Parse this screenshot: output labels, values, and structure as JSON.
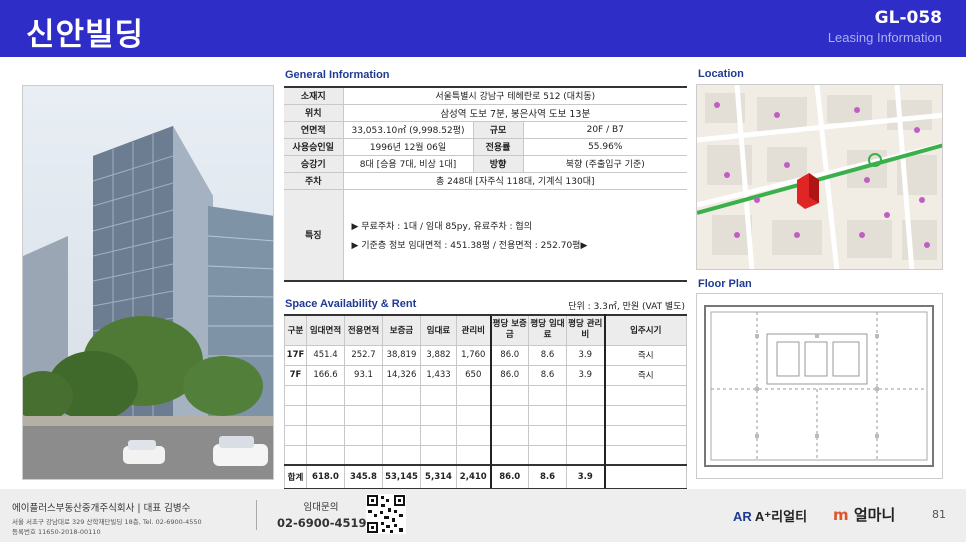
{
  "header": {
    "title": "신안빌딩",
    "code": "GL-058",
    "subtitle": "Leasing Information"
  },
  "general": {
    "section_title": "General Information",
    "address_label": "소재지",
    "address": "서울특별시 강남구 테헤란로 512 (대치동)",
    "location_label": "위치",
    "location": "삼성역 도보 7분, 봉은사역 도보 13분",
    "gfa_label": "연면적",
    "gfa": "33,053.10㎡ (9,998.52평)",
    "scale_label": "규모",
    "scale": "20F / B7",
    "approval_label": "사용승인일",
    "approval": "1996년 12월 06일",
    "efficiency_label": "전용률",
    "efficiency": "55.96%",
    "elevator_label": "승강기",
    "elevator": "8대 [승용 7대, 비상 1대]",
    "direction_label": "방향",
    "direction": "북향 (주출입구 기준)",
    "parking_label": "주차",
    "parking": "총 248대 [자주식 118대, 기계식 130대]",
    "features_label": "특징",
    "features": [
      "▶ 무료주차 : 1대 / 임대 85py, 유료주차 : 협의",
      "▶ 기준층 정보  임대면적 : 451.38평 / 전용면적 : 252.70평▶"
    ]
  },
  "availability": {
    "section_title": "Space Availability & Rent",
    "unit_note": "단위 : 3.3㎡, 만원 (VAT 별도)",
    "headers": [
      "구분",
      "임대면적",
      "전용면적",
      "보증금",
      "임대료",
      "관리비",
      "평당 보증금",
      "평당 임대료",
      "평당 관리비",
      "입주시기"
    ],
    "rows": [
      [
        "17F",
        "451.4",
        "252.7",
        "38,819",
        "3,882",
        "1,760",
        "86.0",
        "8.6",
        "3.9",
        "즉시"
      ],
      [
        "7F",
        "166.6",
        "93.1",
        "14,326",
        "1,433",
        "650",
        "86.0",
        "8.6",
        "3.9",
        "즉시"
      ],
      [
        "",
        "",
        "",
        "",
        "",
        "",
        "",
        "",
        "",
        ""
      ],
      [
        "",
        "",
        "",
        "",
        "",
        "",
        "",
        "",
        "",
        ""
      ],
      [
        "",
        "",
        "",
        "",
        "",
        "",
        "",
        "",
        "",
        ""
      ],
      [
        "",
        "",
        "",
        "",
        "",
        "",
        "",
        "",
        "",
        ""
      ]
    ],
    "total": [
      "합계",
      "618.0",
      "345.8",
      "53,145",
      "5,314",
      "2,410",
      "86.0",
      "8.6",
      "3.9",
      ""
    ]
  },
  "location": {
    "section_title": "Location"
  },
  "floor_plan": {
    "section_title": "Floor Plan"
  },
  "footer": {
    "company": "에이플러스부동산중개주식회사 | 대표 김병수",
    "address": "서울 서초구 강남대로 329 산학재단빌딩 18층,  Tel. 02-6900-4550",
    "registration": "등록번호 11650-2018-00110",
    "inquiry_label": "임대문의",
    "phone": "02-6900-4519",
    "logo_realty": "A⁺리얼티",
    "logo_realty_mark": "AR",
    "logo_money": "얼마니",
    "logo_money_mark": "m",
    "page_number": "81"
  },
  "colors": {
    "header_bg": "#2f2dc8",
    "section_title": "#1f3a93"
  }
}
